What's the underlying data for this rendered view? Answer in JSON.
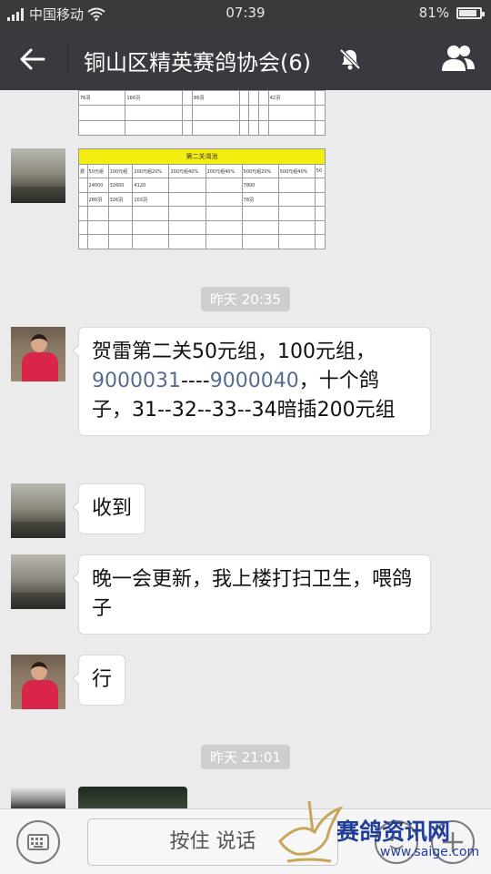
{
  "status_bar": {
    "carrier": "中国移动",
    "time": "07:39",
    "battery": "81%",
    "battery_level": 0.81
  },
  "header": {
    "title": "铜山区精英赛鸽协会(6)"
  },
  "images": {
    "top_sheet": {
      "row1": [
        "76羽",
        "166羽",
        "",
        "86羽",
        "",
        "",
        "",
        "42羽",
        ""
      ]
    },
    "sheet2": {
      "title": "第二关渴池",
      "headers": [
        "费",
        "50元组",
        "100元组",
        "200元组20%",
        "200元组40%",
        "200元组40%",
        "500元组20%",
        "500元组40%",
        "50"
      ],
      "row1": [
        "",
        "24000",
        "32600",
        "4120",
        "",
        "",
        "7800",
        "",
        ""
      ],
      "row2": [
        "",
        "280羽",
        "326羽",
        "103羽",
        "",
        "",
        "78羽",
        "",
        ""
      ]
    }
  },
  "chat": {
    "time1": "昨天 20:35",
    "msg1_part1": "贺雷第二关50元组，100元组，",
    "msg1_link1": "9000031",
    "msg1_mid": "----",
    "msg1_link2": "9000040",
    "msg1_part2": "，十个鸽子，31--32--33--34暗插200元组",
    "msg2": "收到",
    "msg3": "晚一会更新，我上楼打扫卫生，喂鸽子",
    "msg4": "行",
    "time2": "昨天 21:01"
  },
  "input_bar": {
    "hold_to_talk": "按住 说话"
  },
  "watermark": {
    "text": "赛鸽资讯网",
    "url": "www.saige.com"
  }
}
